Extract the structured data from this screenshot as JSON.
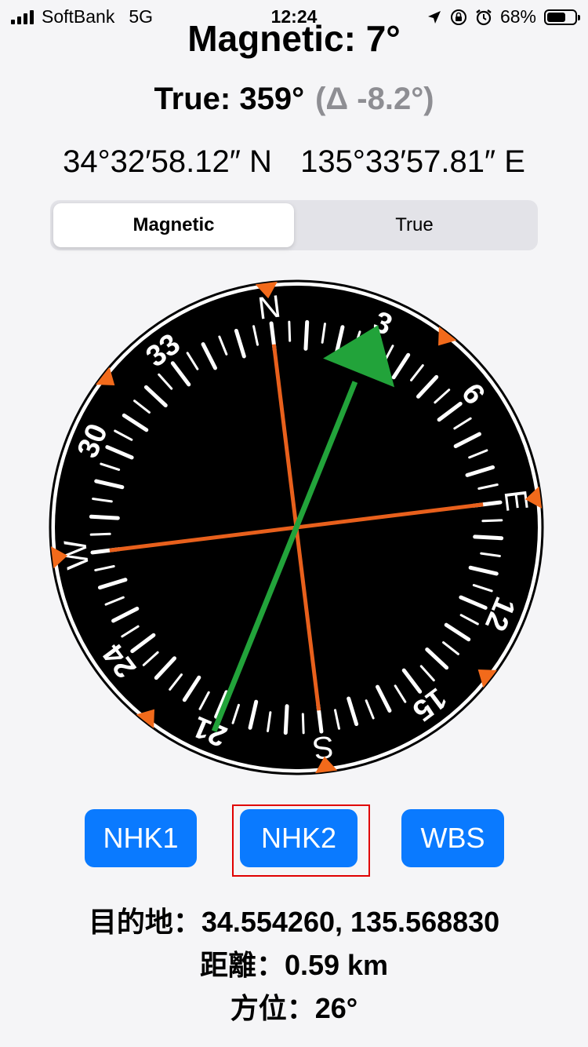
{
  "status_bar": {
    "carrier": "SoftBank",
    "network": "5G",
    "time": "12:24",
    "battery": "68%",
    "battery_level": 0.68,
    "icons": [
      "location-arrow-icon",
      "orientation-lock-icon",
      "alarm-icon"
    ]
  },
  "heading": {
    "magnetic": "Magnetic: 7°",
    "true": "True: 359°",
    "delta": "(Δ -8.2°)"
  },
  "coordinates": {
    "latitude": "34°32′58.12″ N",
    "longitude": "135°33′57.81″ E"
  },
  "mode_selector": {
    "options": [
      "Magnetic",
      "True"
    ],
    "selected": "Magnetic"
  },
  "compass": {
    "rotation_deg": -7,
    "cardinals": [
      "N",
      "E",
      "S",
      "W"
    ],
    "numbers": [
      "3",
      "6",
      "12",
      "15",
      "21",
      "24",
      "30",
      "33"
    ],
    "target_bearing_deg": 26,
    "colors": {
      "face": "#000000",
      "marks": "#ffffff",
      "needle": "#e8601c",
      "arrow": "#22a33a",
      "bezel_triangle": "#f26a1b"
    }
  },
  "station_buttons": {
    "nhk1": "NHK1",
    "nhk2": "NHK2",
    "wbs": "WBS",
    "highlighted": "NHK2"
  },
  "info": {
    "destination": "目的地：34.554260, 135.568830",
    "distance": "距離：0.59 km",
    "bearing": "方位：26°"
  },
  "colors": {
    "accent": "#0a7aff",
    "highlight_box": "#e00000"
  }
}
